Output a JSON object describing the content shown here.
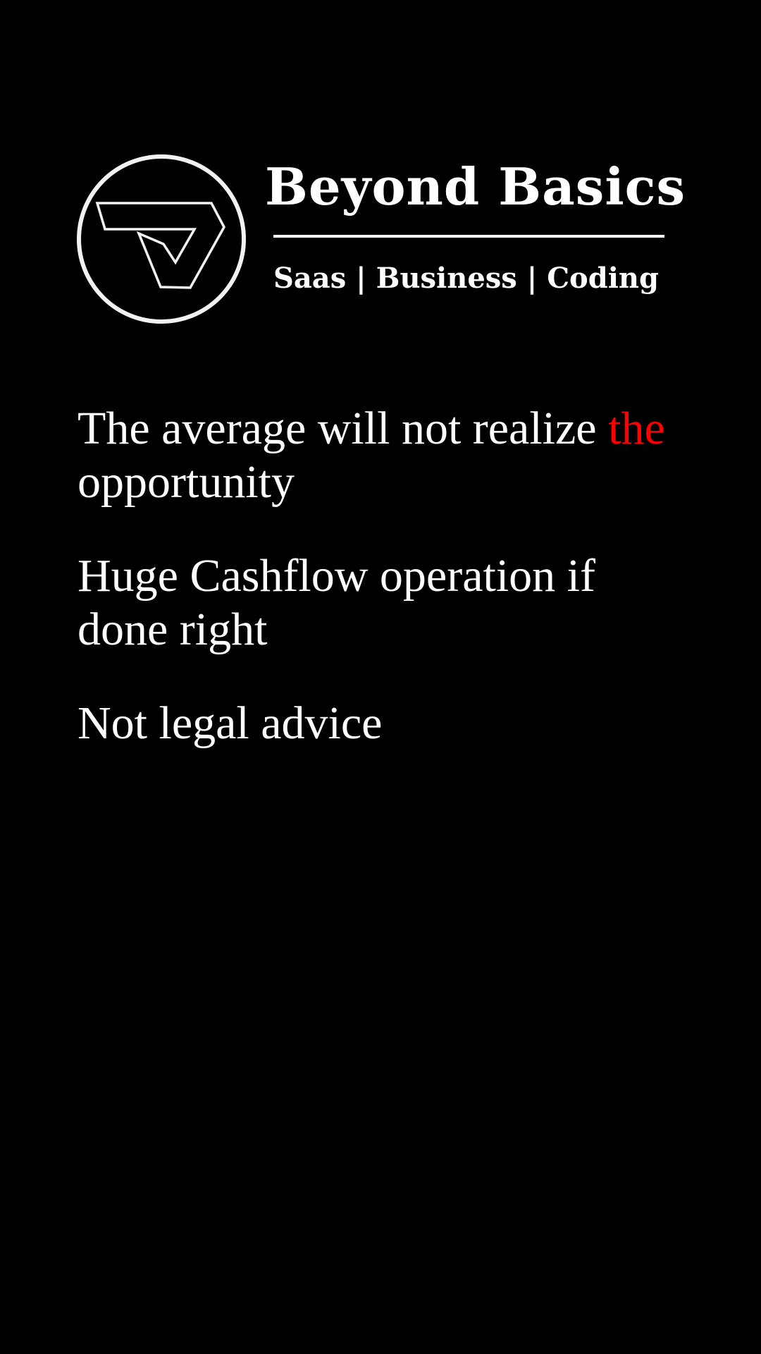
{
  "header": {
    "logo_icon": "beyond-basics-emblem-icon",
    "title": "Beyond Basics",
    "tagline": "Saas | Business | Coding"
  },
  "statements": [
    {
      "text_before": "The average will not realize ",
      "highlight": "the",
      "text_after": " opportunity"
    },
    {
      "text": "Huge Cashflow operation if done right"
    },
    {
      "text": "Not legal advice"
    }
  ],
  "colors": {
    "background": "#000000",
    "text": "#ffffff",
    "accent": "#ff0000"
  }
}
